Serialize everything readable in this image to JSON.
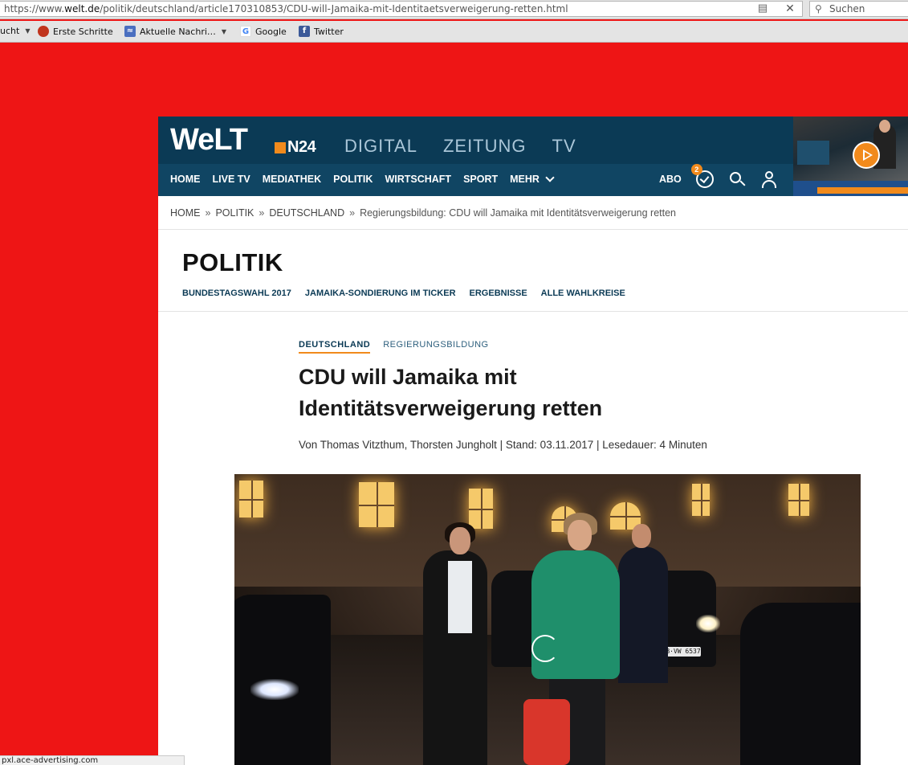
{
  "browser": {
    "url_prefix": "https://www.",
    "url_domain": "welt.de",
    "url_path": "/politik/deutschland/article170310853/CDU-will-Jamaika-mit-Identitaetsverweigerung-retten.html",
    "search_placeholder": "Suchen",
    "bookmarks": [
      {
        "label": "ucht",
        "icon": "folder-icon"
      },
      {
        "label": "Erste Schritte",
        "icon": "firefox-icon"
      },
      {
        "label": "Aktuelle Nachri…",
        "icon": "rss-icon"
      },
      {
        "label": "Google",
        "icon": "google-icon"
      },
      {
        "label": "Twitter",
        "icon": "facebook-icon"
      }
    ],
    "status_text": "pxl.ace-advertising.com"
  },
  "header": {
    "logo": "WeLT",
    "logo_n24": "N24",
    "top_links": [
      "DIGITAL",
      "ZEITUNG",
      "TV"
    ],
    "nav": [
      "HOME",
      "LIVE TV",
      "MEDIATHEK",
      "POLITIK",
      "WIRTSCHAFT",
      "SPORT",
      "MEHR"
    ],
    "abo": "ABO",
    "notification_count": "2",
    "brand_color": "#0b3a55",
    "accent_color": "#f18a1c"
  },
  "breadcrumb": {
    "items": [
      "HOME",
      "POLITIK",
      "DEUTSCHLAND"
    ],
    "separator": "»",
    "current": "Regierungsbildung: CDU will Jamaika mit Identitätsverweigerung retten"
  },
  "section": {
    "title": "POLITIK",
    "subnav": [
      "BUNDESTAGSWAHL 2017",
      "JAMAIKA-SONDIERUNG IM TICKER",
      "ERGEBNISSE",
      "ALLE WAHLKREISE"
    ]
  },
  "article": {
    "kicker_primary": "DEUTSCHLAND",
    "kicker_secondary": "REGIERUNGSBILDUNG",
    "headline_line1": "CDU will Jamaika mit",
    "headline_line2": "Identitätsverweigerung retten",
    "byline": "Von Thomas Vitzthum, Thorsten Jungholt | Stand: 03.11.2017 | Lesedauer: 4 Minuten",
    "plate": "B·VW 6537"
  }
}
